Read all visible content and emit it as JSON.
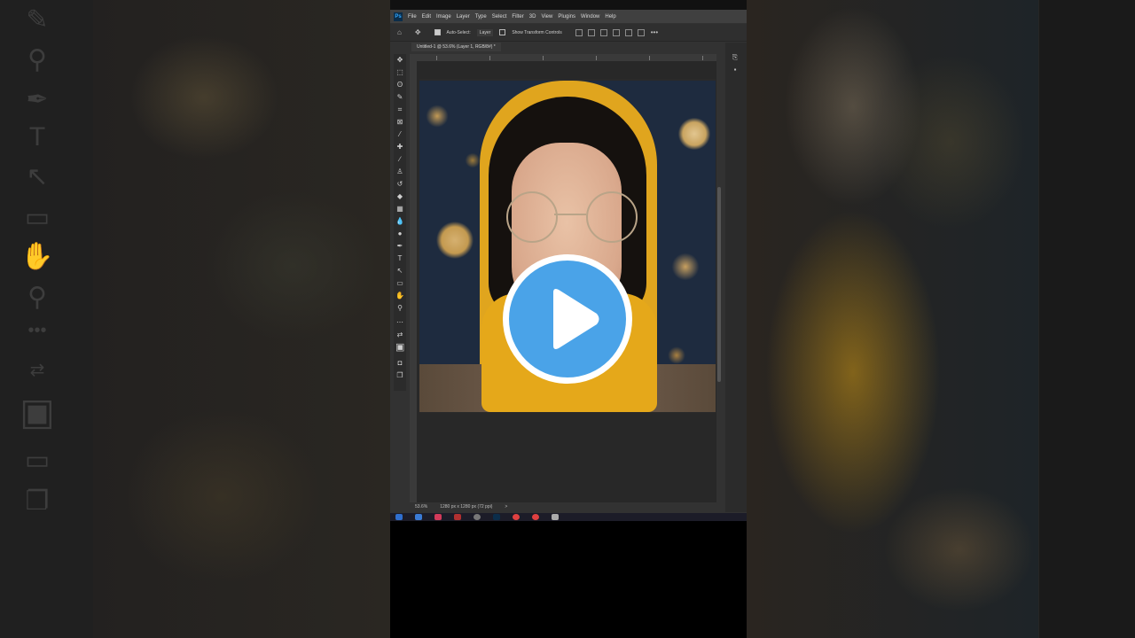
{
  "menubar": {
    "app_badge": "Ps",
    "items": [
      "File",
      "Edit",
      "Image",
      "Layer",
      "Type",
      "Select",
      "Filter",
      "3D",
      "View",
      "Plugins",
      "Window",
      "Help"
    ]
  },
  "options_bar": {
    "auto_select_label": "Auto-Select:",
    "layer_select_value": "Layer",
    "transform_controls_label": "Show Transform Controls"
  },
  "document": {
    "tab_title": "Untitled-1 @ 53.6% (Layer 1, RGB/8#) *"
  },
  "status_bar": {
    "zoom": "53.6%",
    "doc_size": "1280 px x 1280 px (72 ppi)",
    "arrow": ">"
  },
  "icons": {
    "home": "home-icon",
    "move": "move-icon",
    "more": "ellipsis-icon",
    "play": "play-icon"
  },
  "colors": {
    "play_accent": "#4aa3e8",
    "ps_blue": "#31a8ff",
    "scarf_yellow": "#e0a51e"
  }
}
